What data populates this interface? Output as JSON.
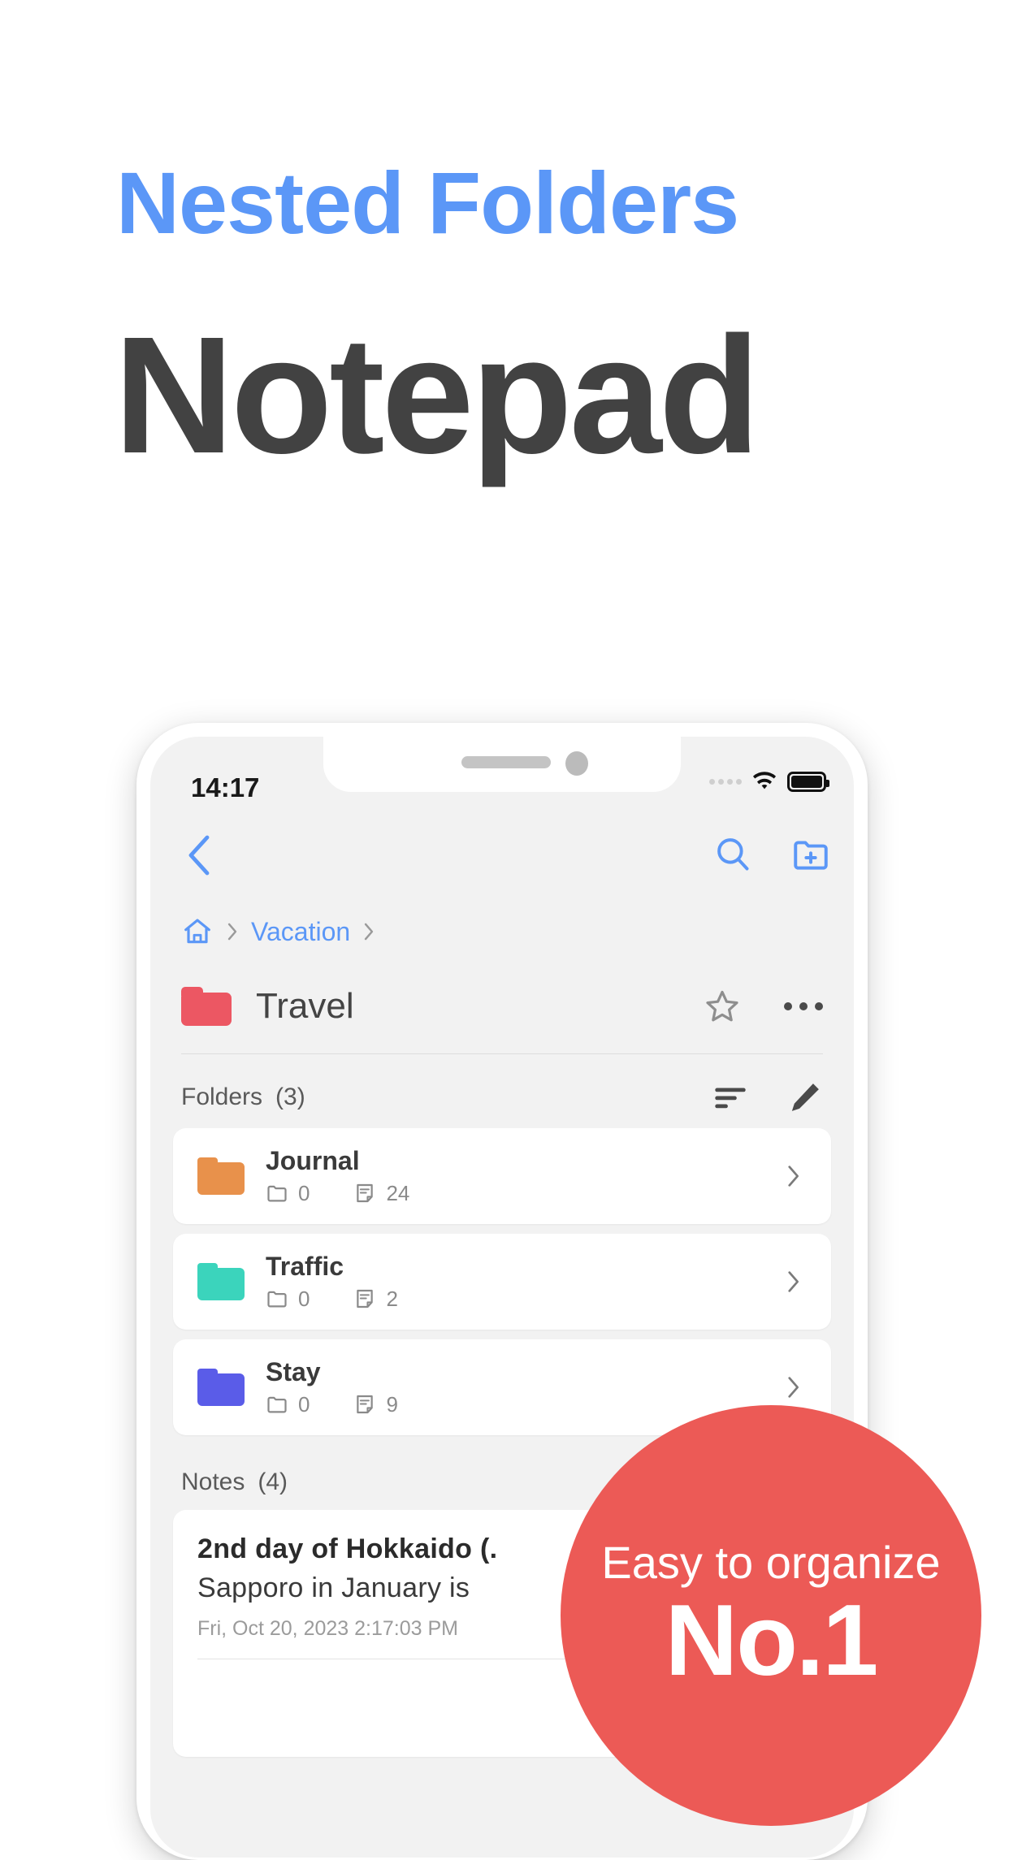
{
  "promo": {
    "subtitle": "Nested Folders",
    "title": "Notepad",
    "subtitle_color": "#5B97F7",
    "title_color": "#424242"
  },
  "badge": {
    "line1": "Easy to organize",
    "line2": "No.1",
    "color": "#EC5A56"
  },
  "phone": {
    "status_bar": {
      "time": "14:17",
      "signal_icon": "signal-dots-icon",
      "wifi_icon": "wifi-icon",
      "battery_icon": "battery-full-icon"
    },
    "app_bar": {
      "back_icon": "chevron-left-icon",
      "search_icon": "search-icon",
      "new_folder_icon": "folder-plus-icon"
    },
    "breadcrumb": {
      "home_icon": "home-icon",
      "separator_icon": "chevron-right-icon",
      "items": [
        {
          "label": "Vacation",
          "color": "#5B97F7"
        }
      ]
    },
    "folder_header": {
      "folder_color": "#EC5763",
      "name": "Travel",
      "favorite_icon": "star-outline-icon",
      "more_icon": "more-horizontal-icon"
    },
    "folders_section": {
      "label": "Folders",
      "count": "(3)",
      "sort_icon": "sort-icon",
      "edit_icon": "pencil-icon",
      "items": [
        {
          "name": "Journal",
          "color": "#E8914B",
          "subfolders": "0",
          "notes": "24",
          "folder_icon": "folder-outline-icon",
          "note_icon": "note-outline-icon",
          "chevron_icon": "chevron-right-icon"
        },
        {
          "name": "Traffic",
          "color": "#3BD4BC",
          "subfolders": "0",
          "notes": "2",
          "folder_icon": "folder-outline-icon",
          "note_icon": "note-outline-icon",
          "chevron_icon": "chevron-right-icon"
        },
        {
          "name": "Stay",
          "color": "#5A5CE8",
          "subfolders": "0",
          "notes": "9",
          "folder_icon": "folder-outline-icon",
          "note_icon": "note-outline-icon",
          "chevron_icon": "chevron-right-icon"
        }
      ]
    },
    "notes_section": {
      "label": "Notes",
      "count": "(4)",
      "items": [
        {
          "title": "2nd day of Hokkaido (.",
          "preview": "Sapporo in January is",
          "date": "Fri, Oct 20, 2023 2:17:03 PM"
        }
      ]
    }
  }
}
